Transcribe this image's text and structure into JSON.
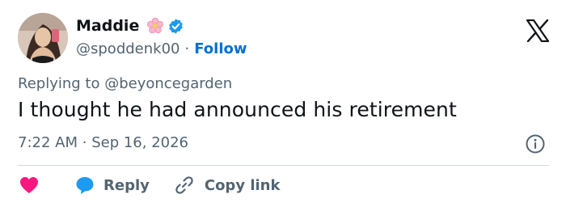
{
  "author": {
    "name": "Maddie",
    "handle": "@spoddenk00",
    "separator": "·",
    "follow_label": "Follow",
    "verified": true,
    "name_emoji": "cherry-blossom-icon",
    "avatar_icon": "profile-photo"
  },
  "tweet": {
    "replying_prefix": "Replying to",
    "replying_to": "@beyoncegarden",
    "text": "I thought he had announced his retirement",
    "time": "7:22 AM",
    "separator": "·",
    "date": "Sep 16, 2026"
  },
  "actions": {
    "like_icon": "heart-icon",
    "reply_label": "Reply",
    "reply_icon": "speech-bubble-icon",
    "copy_label": "Copy link",
    "copy_icon": "link-icon"
  },
  "icons": {
    "platform": "x-logo-icon",
    "info": "info-icon"
  },
  "colors": {
    "text": "#0f1419",
    "secondary": "#536471",
    "follow": "#006fd6",
    "verified": "#1d9bf0",
    "heart": "#f91880",
    "reply_bubble": "#1d9bf0",
    "divider": "#cfd9de"
  }
}
